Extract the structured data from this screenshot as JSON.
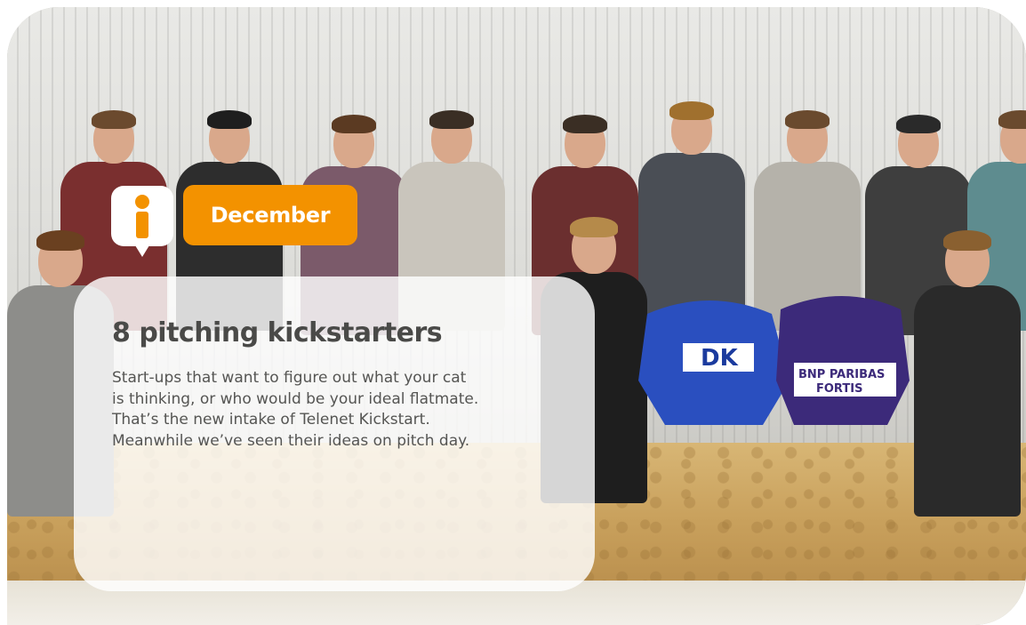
{
  "badge": {
    "icon": "info-icon",
    "month": "December",
    "accent_color": "#f39200"
  },
  "article": {
    "title": "8 pitching kickstarters",
    "body_lines": [
      "Start-ups that want to figure out what your cat",
      "is thinking, or who would be your ideal flatmate.",
      "That’s the new intake of Telenet Kickstart.",
      "Meanwhile we’ve seen their ideas on pitch day."
    ]
  },
  "photo": {
    "jersey_text": [
      "DK",
      "BNP PARIBAS",
      "FORTIS"
    ]
  }
}
